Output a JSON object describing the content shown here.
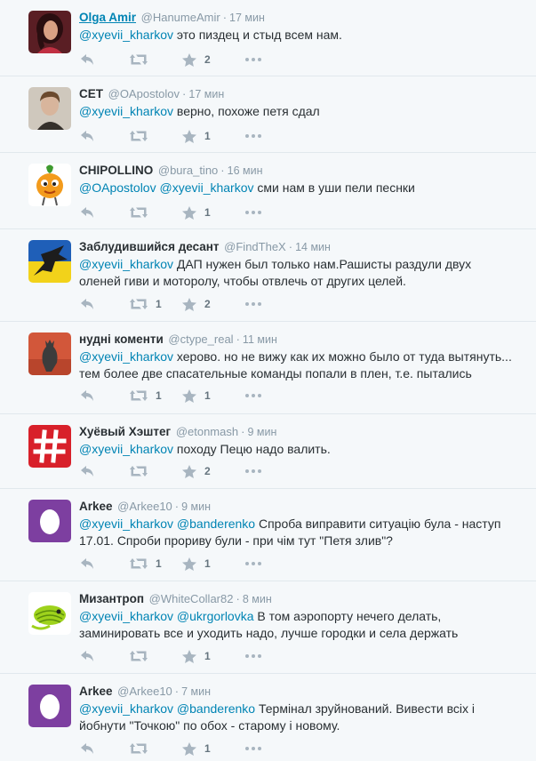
{
  "tweets": [
    {
      "name": "Olga Amir",
      "handle": "@HanumeAmir",
      "time": "17 мин",
      "parts": [
        {
          "mention": "@xyevii_kharkov"
        },
        {
          "text": " это пиздец и стыд  всем нам."
        }
      ],
      "retweets": "",
      "favorites": "2",
      "avatar": "woman-photo"
    },
    {
      "name": "СЕТ",
      "handle": "@OApostolov",
      "time": "17 мин",
      "parts": [
        {
          "mention": "@xyevii_kharkov"
        },
        {
          "text": " верно, похоже петя сдал"
        }
      ],
      "retweets": "",
      "favorites": "1",
      "avatar": "man-photo"
    },
    {
      "name": "CHIPOLLINO",
      "handle": "@bura_tino",
      "time": "16 мин",
      "parts": [
        {
          "mention": "@OApostolov"
        },
        {
          "text": " "
        },
        {
          "mention": "@xyevii_kharkov"
        },
        {
          "text": " сми нам в уши пели песнки"
        }
      ],
      "retweets": "",
      "favorites": "1",
      "avatar": "onion-cartoon"
    },
    {
      "name": "Заблудившийся десант",
      "handle": "@FindTheX",
      "time": "14 мин",
      "parts": [
        {
          "mention": "@xyevii_kharkov"
        },
        {
          "text": " ДАП нужен был только нам.Рашисты раздули двух оленей гиви и моторолу, чтобы отвлечь от других целей."
        }
      ],
      "retweets": "1",
      "favorites": "2",
      "avatar": "blue-yellow-flag-bird"
    },
    {
      "name": "нудні коменти",
      "handle": "@ctype_real",
      "time": "11 мин",
      "parts": [
        {
          "mention": "@xyevii_kharkov"
        },
        {
          "text": " херово. но не вижу как их можно было от туда вытянуть... тем более две спасательные команды попали в плен, т.е. пытались"
        }
      ],
      "retweets": "1",
      "favorites": "1",
      "avatar": "cat-photo"
    },
    {
      "name": "Хуёвый Хэштег",
      "handle": "@etonmash",
      "time": "9 мин",
      "parts": [
        {
          "mention": "@xyevii_kharkov"
        },
        {
          "text": " походу Пецю надо валить."
        }
      ],
      "retweets": "",
      "favorites": "2",
      "avatar": "hashtag-logo"
    },
    {
      "name": "Arkee",
      "handle": "@Arkee10",
      "time": "9 мин",
      "parts": [
        {
          "mention": "@xyevii_kharkov"
        },
        {
          "text": " "
        },
        {
          "mention": "@banderenko"
        },
        {
          "text": " Спроба виправити ситуацію була - наступ 17.01. Спроби прориву були - при чім тут \"Петя злив\"?"
        }
      ],
      "retweets": "1",
      "favorites": "1",
      "avatar": "default-egg"
    },
    {
      "name": "Мизантроп",
      "handle": "@WhiteCollar82",
      "time": "8 мин",
      "parts": [
        {
          "mention": "@xyevii_kharkov"
        },
        {
          "text": " "
        },
        {
          "mention": "@ukrgorlovka"
        },
        {
          "text": " В том аэропорту нечего делать, заминировать все и уходить надо, лучше городки и села держать"
        }
      ],
      "retweets": "",
      "favorites": "1",
      "avatar": "green-lizard"
    },
    {
      "name": "Arkee",
      "handle": "@Arkee10",
      "time": "7 мин",
      "parts": [
        {
          "mention": "@xyevii_kharkov"
        },
        {
          "text": " "
        },
        {
          "mention": "@banderenko"
        },
        {
          "text": " Термінал зруйнований. Вивести всіх і йобнути \"Точкою\" по обох - старому і новому."
        }
      ],
      "retweets": "",
      "favorites": "1",
      "avatar": "default-egg"
    }
  ],
  "colors": {
    "link": "#0084b4",
    "action_icon": "#a8b5c0",
    "egg_bg": "#7d3fa0",
    "hashtag_bg": "#d8202a",
    "bg": "#f5f8fa"
  }
}
